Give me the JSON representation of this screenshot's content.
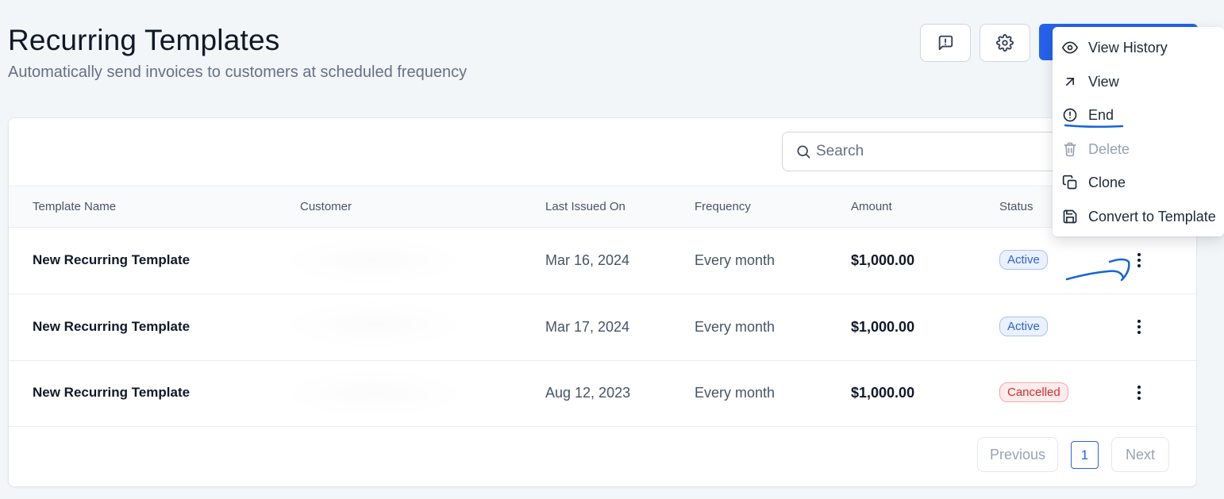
{
  "header": {
    "title": "Recurring Templates",
    "subtitle": "Automatically send invoices to customers at scheduled frequency",
    "feedback_icon": "feedback-icon",
    "settings_icon": "gear-icon",
    "primary_color": "#2563eb"
  },
  "search": {
    "placeholder": "Search"
  },
  "table": {
    "columns": [
      "Template Name",
      "Customer",
      "Last Issued On",
      "Frequency",
      "Amount",
      "Status"
    ],
    "rows": [
      {
        "name": "New Recurring Template",
        "customer": "",
        "last_issued": "Mar 16, 2024",
        "frequency": "Every month",
        "amount": "$1,000.00",
        "status": "Active"
      },
      {
        "name": "New Recurring Template",
        "customer": "",
        "last_issued": "Mar 17, 2024",
        "frequency": "Every month",
        "amount": "$1,000.00",
        "status": "Active"
      },
      {
        "name": "New Recurring Template",
        "customer": "",
        "last_issued": "Aug 12, 2023",
        "frequency": "Every month",
        "amount": "$1,000.00",
        "status": "Cancelled"
      }
    ]
  },
  "pagination": {
    "previous": "Previous",
    "current_page": "1",
    "next": "Next"
  },
  "menu": {
    "items": [
      {
        "label": "View History",
        "icon": "eye-icon",
        "disabled": false
      },
      {
        "label": "View",
        "icon": "arrow-up-right-icon",
        "disabled": false
      },
      {
        "label": "End",
        "icon": "alert-circle-icon",
        "disabled": false
      },
      {
        "label": "Delete",
        "icon": "trash-icon",
        "disabled": true
      },
      {
        "label": "Clone",
        "icon": "copy-icon",
        "disabled": false
      },
      {
        "label": "Convert to Template",
        "icon": "save-icon",
        "disabled": false
      }
    ]
  },
  "status_colors": {
    "active": "#2f62c9",
    "cancelled": "#d12c2c"
  }
}
